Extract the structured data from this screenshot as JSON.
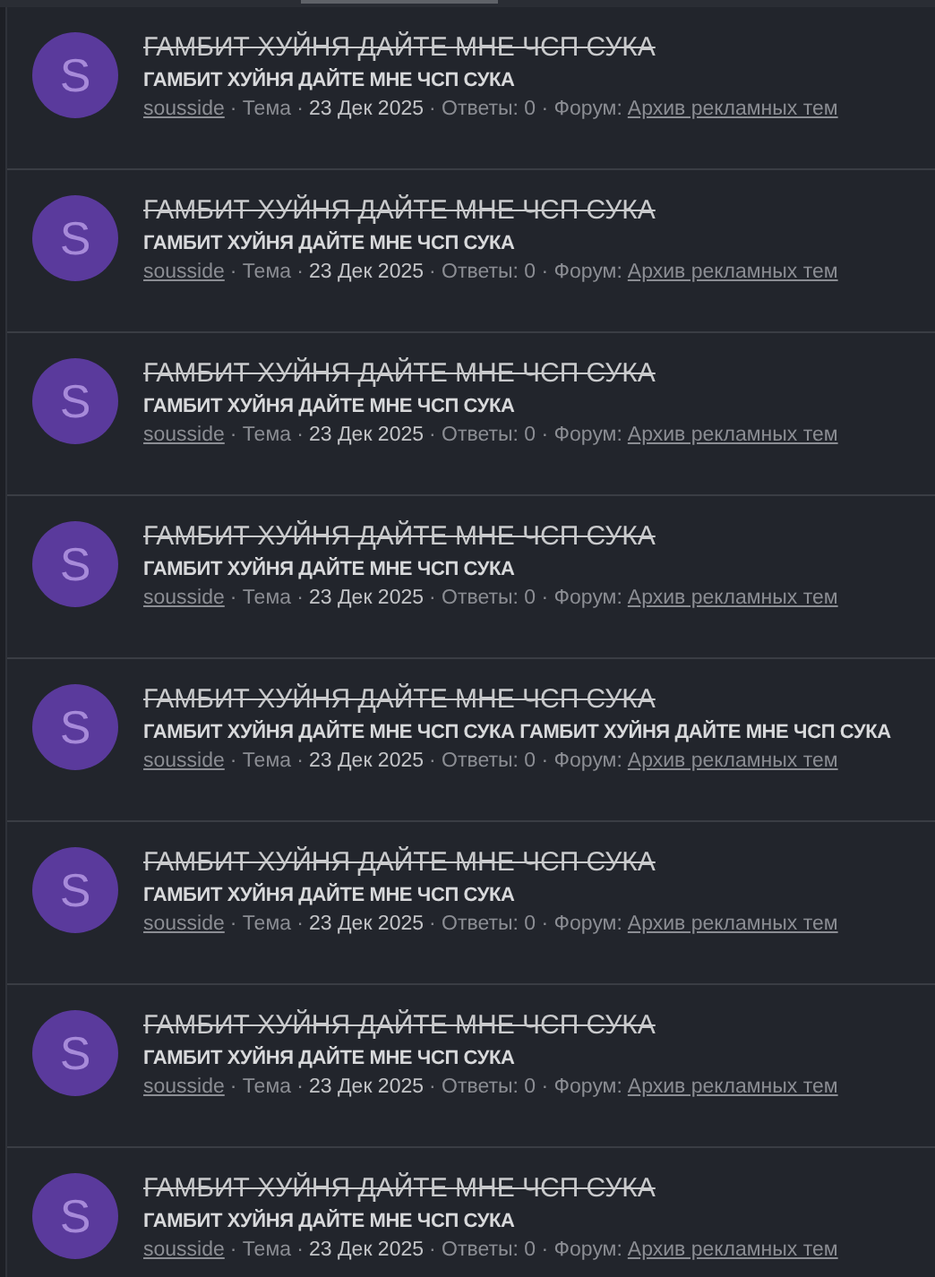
{
  "results": [
    {
      "avatar": "S",
      "title": "ГАМБИТ ХУЙНЯ ДАЙТЕ МНЕ ЧСП СУКА",
      "struck": true,
      "snippet": "ГАМБИТ ХУЙНЯ ДАЙТЕ МНЕ ЧСП СУКА",
      "meta": [
        {
          "kind": "link",
          "text": "sousside"
        },
        {
          "kind": "text",
          "text": "· Тема ·"
        },
        {
          "kind": "bold",
          "text": "23 Дек 2025"
        },
        {
          "kind": "text",
          "text": "· Ответы: 0 · Форум:"
        },
        {
          "kind": "link",
          "text": "Архив рекламных тем"
        }
      ]
    },
    {
      "avatar": "S",
      "title": "ГАМБИТ ХУЙНЯ ДАЙТЕ МНЕ ЧСП СУКА",
      "struck": true,
      "snippet": "ГАМБИТ ХУЙНЯ ДАЙТЕ МНЕ ЧСП СУКА",
      "meta": [
        {
          "kind": "link",
          "text": "sousside"
        },
        {
          "kind": "text",
          "text": "· Тема ·"
        },
        {
          "kind": "bold",
          "text": "23 Дек 2025"
        },
        {
          "kind": "text",
          "text": "· Ответы: 0 · Форум:"
        },
        {
          "kind": "link",
          "text": "Архив рекламных тем"
        }
      ]
    },
    {
      "avatar": "S",
      "title": "ГАМБИТ ХУЙНЯ ДАЙТЕ МНЕ ЧСП СУКА",
      "struck": true,
      "snippet": "ГАМБИТ ХУЙНЯ ДАЙТЕ МНЕ ЧСП СУКА",
      "meta": [
        {
          "kind": "link",
          "text": "sousside"
        },
        {
          "kind": "text",
          "text": "· Тема ·"
        },
        {
          "kind": "bold",
          "text": "23 Дек 2025"
        },
        {
          "kind": "text",
          "text": "· Ответы: 0 · Форум:"
        },
        {
          "kind": "link",
          "text": "Архив рекламных тем"
        }
      ]
    },
    {
      "avatar": "S",
      "title": "ГАМБИТ ХУЙНЯ ДАЙТЕ МНЕ ЧСП СУКА",
      "struck": true,
      "snippet": "ГАМБИТ ХУЙНЯ ДАЙТЕ МНЕ ЧСП СУКА",
      "meta": [
        {
          "kind": "link",
          "text": "sousside"
        },
        {
          "kind": "text",
          "text": "· Тема ·"
        },
        {
          "kind": "bold",
          "text": "23 Дек 2025"
        },
        {
          "kind": "text",
          "text": "· Ответы: 0 · Форум:"
        },
        {
          "kind": "link",
          "text": "Архив рекламных тем"
        }
      ]
    },
    {
      "avatar": "S",
      "title": "ГАМБИТ ХУЙНЯ ДАЙТЕ МНЕ ЧСП СУКА",
      "struck": true,
      "snippet": "ГАМБИТ ХУЙНЯ ДАЙТЕ МНЕ ЧСП СУКА ГАМБИТ ХУЙНЯ ДАЙТЕ МНЕ ЧСП СУКА",
      "meta": [
        {
          "kind": "link",
          "text": "sousside"
        },
        {
          "kind": "text",
          "text": "· Тема ·"
        },
        {
          "kind": "bold",
          "text": "23 Дек 2025"
        },
        {
          "kind": "text",
          "text": "· Ответы: 0 · Форум:"
        },
        {
          "kind": "link",
          "text": "Архив рекламных тем"
        }
      ]
    },
    {
      "avatar": "S",
      "title": "ГАМБИТ ХУЙНЯ ДАЙТЕ МНЕ ЧСП СУКА",
      "struck": true,
      "snippet": "ГАМБИТ ХУЙНЯ ДАЙТЕ МНЕ ЧСП СУКА",
      "meta": [
        {
          "kind": "link",
          "text": "sousside"
        },
        {
          "kind": "text",
          "text": "· Тема ·"
        },
        {
          "kind": "bold",
          "text": "23 Дек 2025"
        },
        {
          "kind": "text",
          "text": "· Ответы: 0 · Форум:"
        },
        {
          "kind": "link",
          "text": "Архив рекламных тем"
        }
      ]
    },
    {
      "avatar": "S",
      "title": "ГАМБИТ ХУЙНЯ ДАЙТЕ МНЕ ЧСП СУКА",
      "struck": true,
      "snippet": "ГАМБИТ ХУЙНЯ ДАЙТЕ МНЕ ЧСП СУКА",
      "meta": [
        {
          "kind": "link",
          "text": "sousside"
        },
        {
          "kind": "text",
          "text": "· Тема ·"
        },
        {
          "kind": "bold",
          "text": "23 Дек 2025"
        },
        {
          "kind": "text",
          "text": "· Ответы: 0 · Форум:"
        },
        {
          "kind": "link",
          "text": "Архив рекламных тем"
        }
      ]
    },
    {
      "avatar": "S",
      "title": "ГАМБИТ ХУЙНЯ ДАЙТЕ МНЕ ЧСП СУКА",
      "struck": true,
      "snippet": "ГАМБИТ ХУЙНЯ ДАЙТЕ МНЕ ЧСП СУКА",
      "meta": [
        {
          "kind": "link",
          "text": "sousside"
        },
        {
          "kind": "text",
          "text": "· Тема ·"
        },
        {
          "kind": "bold",
          "text": "23 Дек 2025"
        },
        {
          "kind": "text",
          "text": "· Ответы: 0 · Форум:"
        },
        {
          "kind": "link",
          "text": "Архив рекламных тем"
        }
      ]
    }
  ]
}
